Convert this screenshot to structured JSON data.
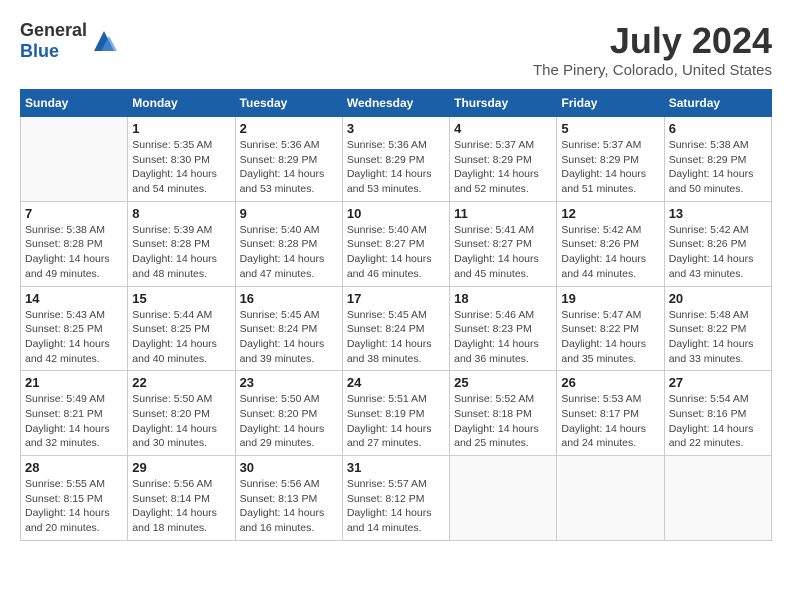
{
  "header": {
    "logo_general": "General",
    "logo_blue": "Blue",
    "month_year": "July 2024",
    "location": "The Pinery, Colorado, United States"
  },
  "days_of_week": [
    "Sunday",
    "Monday",
    "Tuesday",
    "Wednesday",
    "Thursday",
    "Friday",
    "Saturday"
  ],
  "weeks": [
    [
      {
        "day": "",
        "info": ""
      },
      {
        "day": "1",
        "info": "Sunrise: 5:35 AM\nSunset: 8:30 PM\nDaylight: 14 hours\nand 54 minutes."
      },
      {
        "day": "2",
        "info": "Sunrise: 5:36 AM\nSunset: 8:29 PM\nDaylight: 14 hours\nand 53 minutes."
      },
      {
        "day": "3",
        "info": "Sunrise: 5:36 AM\nSunset: 8:29 PM\nDaylight: 14 hours\nand 53 minutes."
      },
      {
        "day": "4",
        "info": "Sunrise: 5:37 AM\nSunset: 8:29 PM\nDaylight: 14 hours\nand 52 minutes."
      },
      {
        "day": "5",
        "info": "Sunrise: 5:37 AM\nSunset: 8:29 PM\nDaylight: 14 hours\nand 51 minutes."
      },
      {
        "day": "6",
        "info": "Sunrise: 5:38 AM\nSunset: 8:29 PM\nDaylight: 14 hours\nand 50 minutes."
      }
    ],
    [
      {
        "day": "7",
        "info": "Sunrise: 5:38 AM\nSunset: 8:28 PM\nDaylight: 14 hours\nand 49 minutes."
      },
      {
        "day": "8",
        "info": "Sunrise: 5:39 AM\nSunset: 8:28 PM\nDaylight: 14 hours\nand 48 minutes."
      },
      {
        "day": "9",
        "info": "Sunrise: 5:40 AM\nSunset: 8:28 PM\nDaylight: 14 hours\nand 47 minutes."
      },
      {
        "day": "10",
        "info": "Sunrise: 5:40 AM\nSunset: 8:27 PM\nDaylight: 14 hours\nand 46 minutes."
      },
      {
        "day": "11",
        "info": "Sunrise: 5:41 AM\nSunset: 8:27 PM\nDaylight: 14 hours\nand 45 minutes."
      },
      {
        "day": "12",
        "info": "Sunrise: 5:42 AM\nSunset: 8:26 PM\nDaylight: 14 hours\nand 44 minutes."
      },
      {
        "day": "13",
        "info": "Sunrise: 5:42 AM\nSunset: 8:26 PM\nDaylight: 14 hours\nand 43 minutes."
      }
    ],
    [
      {
        "day": "14",
        "info": "Sunrise: 5:43 AM\nSunset: 8:25 PM\nDaylight: 14 hours\nand 42 minutes."
      },
      {
        "day": "15",
        "info": "Sunrise: 5:44 AM\nSunset: 8:25 PM\nDaylight: 14 hours\nand 40 minutes."
      },
      {
        "day": "16",
        "info": "Sunrise: 5:45 AM\nSunset: 8:24 PM\nDaylight: 14 hours\nand 39 minutes."
      },
      {
        "day": "17",
        "info": "Sunrise: 5:45 AM\nSunset: 8:24 PM\nDaylight: 14 hours\nand 38 minutes."
      },
      {
        "day": "18",
        "info": "Sunrise: 5:46 AM\nSunset: 8:23 PM\nDaylight: 14 hours\nand 36 minutes."
      },
      {
        "day": "19",
        "info": "Sunrise: 5:47 AM\nSunset: 8:22 PM\nDaylight: 14 hours\nand 35 minutes."
      },
      {
        "day": "20",
        "info": "Sunrise: 5:48 AM\nSunset: 8:22 PM\nDaylight: 14 hours\nand 33 minutes."
      }
    ],
    [
      {
        "day": "21",
        "info": "Sunrise: 5:49 AM\nSunset: 8:21 PM\nDaylight: 14 hours\nand 32 minutes."
      },
      {
        "day": "22",
        "info": "Sunrise: 5:50 AM\nSunset: 8:20 PM\nDaylight: 14 hours\nand 30 minutes."
      },
      {
        "day": "23",
        "info": "Sunrise: 5:50 AM\nSunset: 8:20 PM\nDaylight: 14 hours\nand 29 minutes."
      },
      {
        "day": "24",
        "info": "Sunrise: 5:51 AM\nSunset: 8:19 PM\nDaylight: 14 hours\nand 27 minutes."
      },
      {
        "day": "25",
        "info": "Sunrise: 5:52 AM\nSunset: 8:18 PM\nDaylight: 14 hours\nand 25 minutes."
      },
      {
        "day": "26",
        "info": "Sunrise: 5:53 AM\nSunset: 8:17 PM\nDaylight: 14 hours\nand 24 minutes."
      },
      {
        "day": "27",
        "info": "Sunrise: 5:54 AM\nSunset: 8:16 PM\nDaylight: 14 hours\nand 22 minutes."
      }
    ],
    [
      {
        "day": "28",
        "info": "Sunrise: 5:55 AM\nSunset: 8:15 PM\nDaylight: 14 hours\nand 20 minutes."
      },
      {
        "day": "29",
        "info": "Sunrise: 5:56 AM\nSunset: 8:14 PM\nDaylight: 14 hours\nand 18 minutes."
      },
      {
        "day": "30",
        "info": "Sunrise: 5:56 AM\nSunset: 8:13 PM\nDaylight: 14 hours\nand 16 minutes."
      },
      {
        "day": "31",
        "info": "Sunrise: 5:57 AM\nSunset: 8:12 PM\nDaylight: 14 hours\nand 14 minutes."
      },
      {
        "day": "",
        "info": ""
      },
      {
        "day": "",
        "info": ""
      },
      {
        "day": "",
        "info": ""
      }
    ]
  ]
}
